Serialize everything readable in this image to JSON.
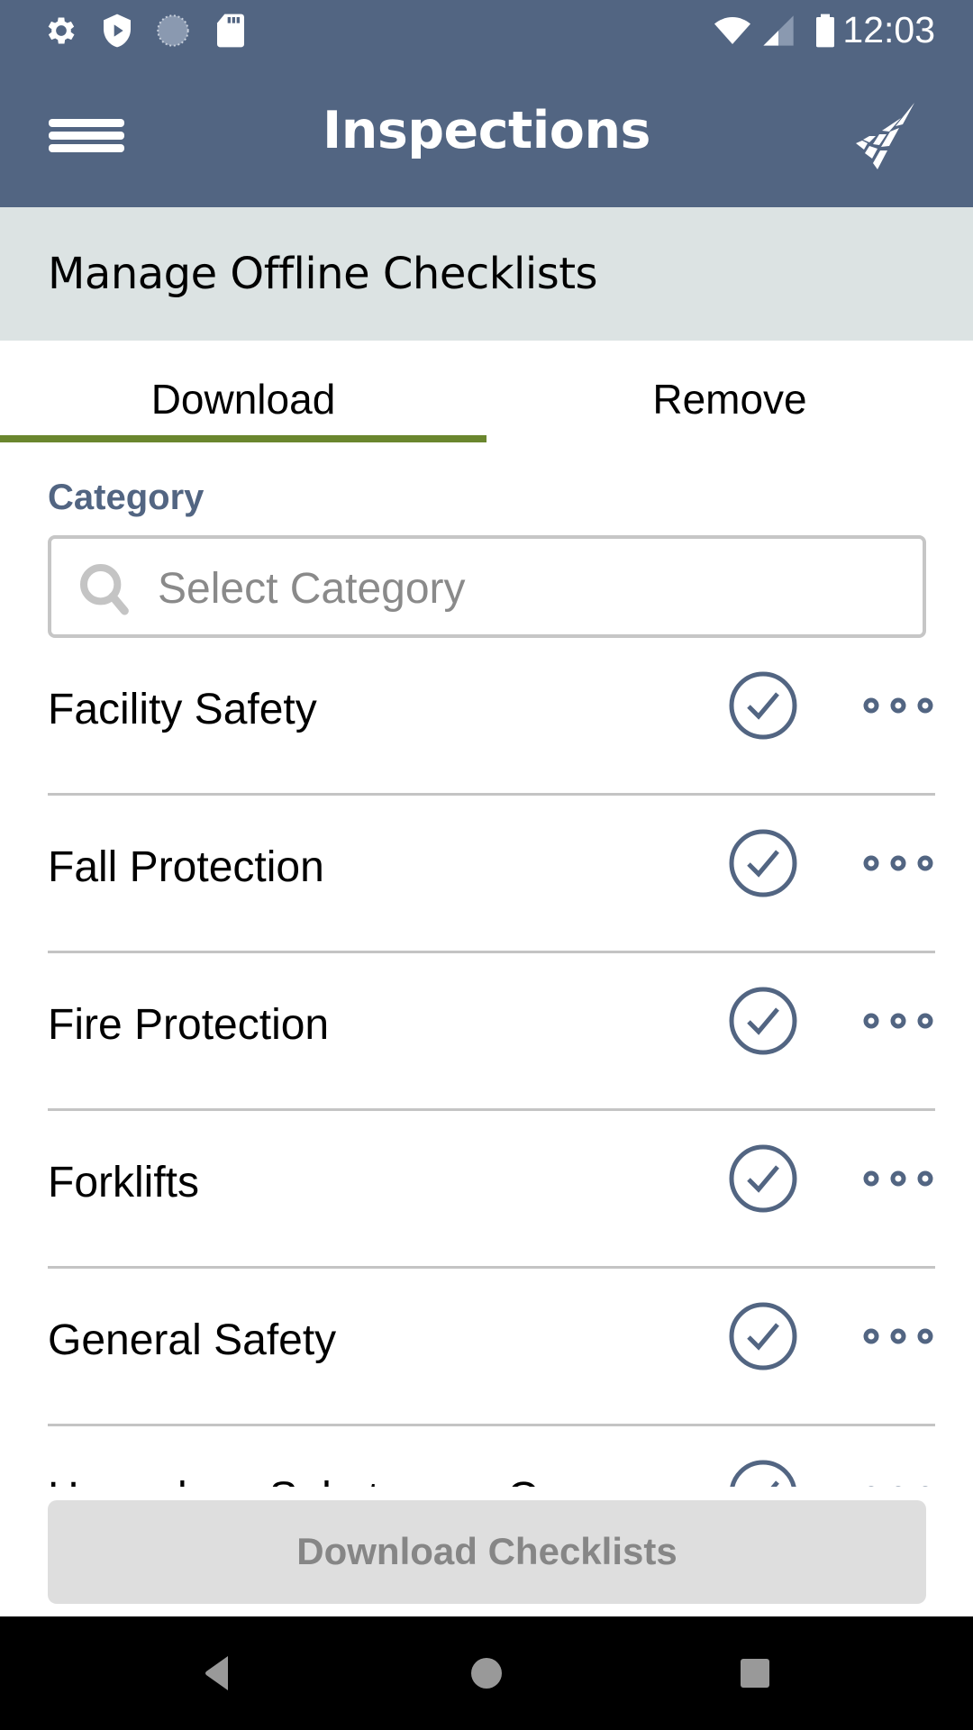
{
  "status_bar": {
    "left_icons": [
      "gear-icon",
      "shield-play-icon",
      "sync-spinner-icon",
      "sd-card-icon"
    ],
    "right_icons": [
      "wifi-icon",
      "cell-signal-icon",
      "battery-icon"
    ],
    "time": "12:03"
  },
  "app_bar": {
    "title": "Inspections",
    "menu_icon": "hamburger-menu-icon",
    "logo_icon": "brand-logo-icon"
  },
  "sub_header": {
    "title": "Manage Offline Checklists"
  },
  "tabs": [
    {
      "label": "Download",
      "active": true
    },
    {
      "label": "Remove",
      "active": false
    }
  ],
  "category": {
    "label": "Category",
    "placeholder": "Select Category",
    "value": ""
  },
  "checklists": [
    {
      "name": "Facility Safety",
      "selected": true
    },
    {
      "name": "Fall Protection",
      "selected": true
    },
    {
      "name": "Fire Protection",
      "selected": true
    },
    {
      "name": "Forklifts",
      "selected": true
    },
    {
      "name": "General Safety",
      "selected": true
    },
    {
      "name": "Hazardous Substances Commun",
      "selected": true
    }
  ],
  "footer": {
    "download_button": "Download Checklists",
    "enabled": false
  },
  "nav_bar": {
    "buttons": [
      "back-icon",
      "home-icon",
      "recents-icon"
    ]
  },
  "colors": {
    "primary": "#526582",
    "subheader_bg": "#dce3e3",
    "tab_indicator": "#6a862e",
    "icon_accent": "#526582",
    "disabled_button_bg": "#dedede",
    "disabled_button_text": "#868686"
  }
}
